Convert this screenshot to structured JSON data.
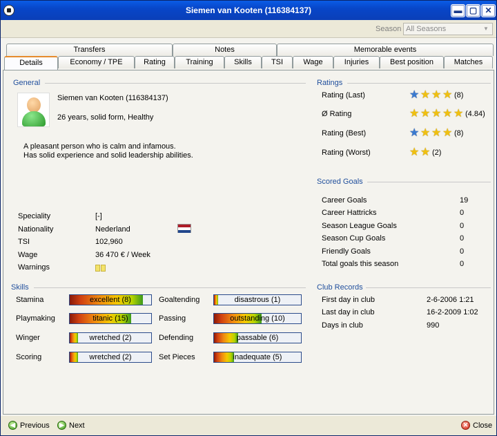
{
  "window": {
    "title": "Siemen  van Kooten (116384137)",
    "minimize": "▬",
    "maximize": "▢",
    "close": "✕"
  },
  "season": {
    "label": "Season",
    "selected": "All Seasons"
  },
  "tabs_top": [
    "Transfers",
    "Notes",
    "Memorable events"
  ],
  "tabs_bottom": [
    "Details",
    "Economy / TPE",
    "Rating",
    "Training",
    "Skills",
    "TSI",
    "Wage",
    "Injuries",
    "Best position",
    "Matches"
  ],
  "general": {
    "title": "General",
    "name": "Siemen  van Kooten (116384137)",
    "status": "26 years, solid form, Healthy",
    "desc1": "A pleasant person who is calm and infamous.",
    "desc2": "Has solid experience and solid leadership abilities."
  },
  "info": [
    {
      "label": "Speciality",
      "value": "[-]"
    },
    {
      "label": "Nationality",
      "value": "Nederland"
    },
    {
      "label": "TSI",
      "value": "102,960"
    },
    {
      "label": "Wage",
      "value": "36 470 € / Week"
    },
    {
      "label": "Warnings",
      "value": ""
    }
  ],
  "flag": {
    "top": "#ae1c28",
    "middle": "#ffffff",
    "bottom": "#21468b"
  },
  "skills": {
    "title": "Skills",
    "items": [
      {
        "name": "Stamina",
        "value": "excellent (8)",
        "fill": 0.9
      },
      {
        "name": "Goaltending",
        "value": "disastrous (1)",
        "fill": 0.05
      },
      {
        "name": "Playmaking",
        "value": "titanic (15)",
        "fill": 0.75
      },
      {
        "name": "Passing",
        "value": "outstanding (10)",
        "fill": 0.55
      },
      {
        "name": "Winger",
        "value": "wretched (2)",
        "fill": 0.1
      },
      {
        "name": "Defending",
        "value": "passable (6)",
        "fill": 0.28
      },
      {
        "name": "Scoring",
        "value": "wretched (2)",
        "fill": 0.1
      },
      {
        "name": "Set Pieces",
        "value": "inadequate (5)",
        "fill": 0.23
      }
    ]
  },
  "ratings": {
    "title": "Ratings",
    "items": [
      {
        "label": "Rating (Last)",
        "value": "(8)",
        "stars": [
          "blue",
          "gold",
          "gold",
          "gold"
        ]
      },
      {
        "label": "Ø Rating",
        "value": "(4.84)",
        "stars": [
          "gold",
          "gold",
          "gold",
          "gold",
          "gold"
        ]
      },
      {
        "label": "Rating (Best)",
        "value": "(8)",
        "stars": [
          "blue",
          "gold",
          "gold",
          "gold"
        ]
      },
      {
        "label": "Rating (Worst)",
        "value": "(2)",
        "stars": [
          "gold",
          "gold"
        ]
      }
    ]
  },
  "goals": {
    "title": "Scored Goals",
    "items": [
      {
        "label": "Career Goals",
        "value": "19"
      },
      {
        "label": "Career Hattricks",
        "value": "0"
      },
      {
        "label": "Season League Goals",
        "value": "0"
      },
      {
        "label": "Season Cup Goals",
        "value": "0"
      },
      {
        "label": "Friendly Goals",
        "value": "0"
      },
      {
        "label": "Total goals this season",
        "value": "0"
      }
    ]
  },
  "club": {
    "title": "Club Records",
    "items": [
      {
        "label": "First day in club",
        "value": "2-6-2006 1:21"
      },
      {
        "label": "Last day in club",
        "value": "16-2-2009 1:02"
      },
      {
        "label": "Days in club",
        "value": "990"
      }
    ]
  },
  "footer": {
    "previous": "Previous",
    "next": "Next",
    "close": "Close"
  }
}
